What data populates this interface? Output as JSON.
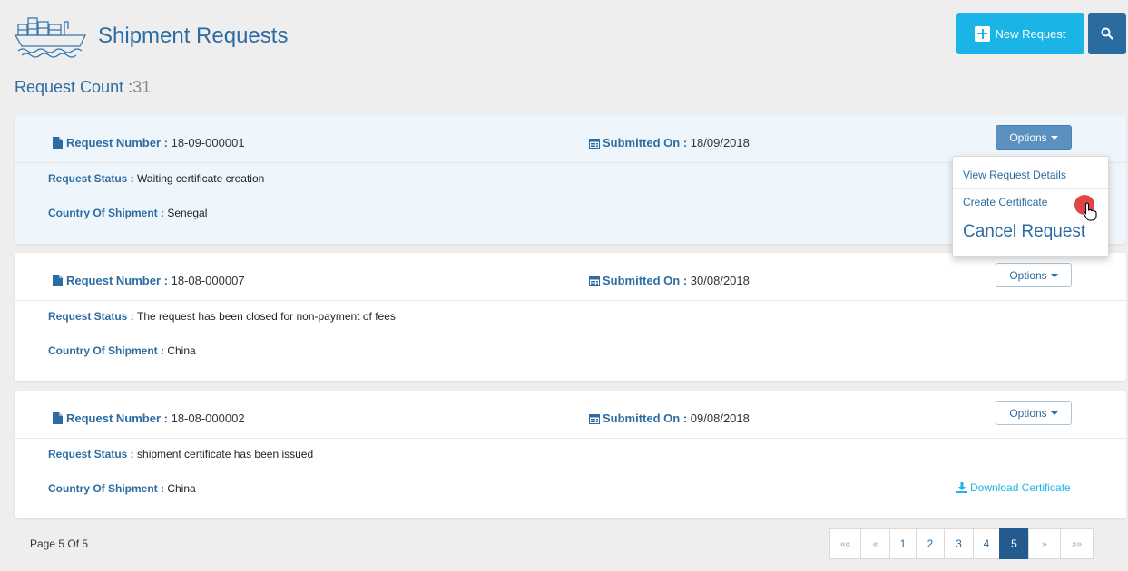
{
  "header": {
    "title": "Shipment Requests",
    "new_request_label": "New Request"
  },
  "request_count": {
    "label": "Request Count :",
    "value": "31"
  },
  "labels": {
    "request_number": "Request Number :",
    "submitted_on": "Submitted On :",
    "request_status": "Request Status :",
    "country_of_shipment": "Country Of Shipment :",
    "options": "Options"
  },
  "requests": [
    {
      "number": "18-09-000001",
      "submitted_on": "18/09/2018",
      "status": "Waiting certificate creation",
      "country": "Senegal"
    },
    {
      "number": "18-08-000007",
      "submitted_on": "30/08/2018",
      "status": "The request has been closed for non-payment of fees",
      "country": "China"
    },
    {
      "number": "18-08-000002",
      "submitted_on": "09/08/2018",
      "status": "shipment certificate has been issued",
      "country": "China",
      "download_label": "Download Certificate"
    }
  ],
  "options_menu": {
    "items": [
      "View Request Details",
      "Create Certificate",
      "Cancel Request"
    ]
  },
  "pagination": {
    "info": "Page 5 Of 5",
    "first": "««",
    "prev": "«",
    "pages": [
      "1",
      "2",
      "3",
      "4",
      "5"
    ],
    "current_page": "5",
    "next": "»",
    "last": "»»"
  },
  "colors": {
    "primary_text": "#2d6ca2",
    "new_request_bg": "#1ab5e6",
    "search_bg": "#2a6ca0",
    "active_page_bg": "#245b8f",
    "cursor_dot": "#e04545"
  },
  "icons": {
    "logo": "ship-icon",
    "search": "search-icon",
    "new": "plus-square-icon",
    "document": "file-icon",
    "calendar": "calendar-icon",
    "download": "download-icon"
  }
}
